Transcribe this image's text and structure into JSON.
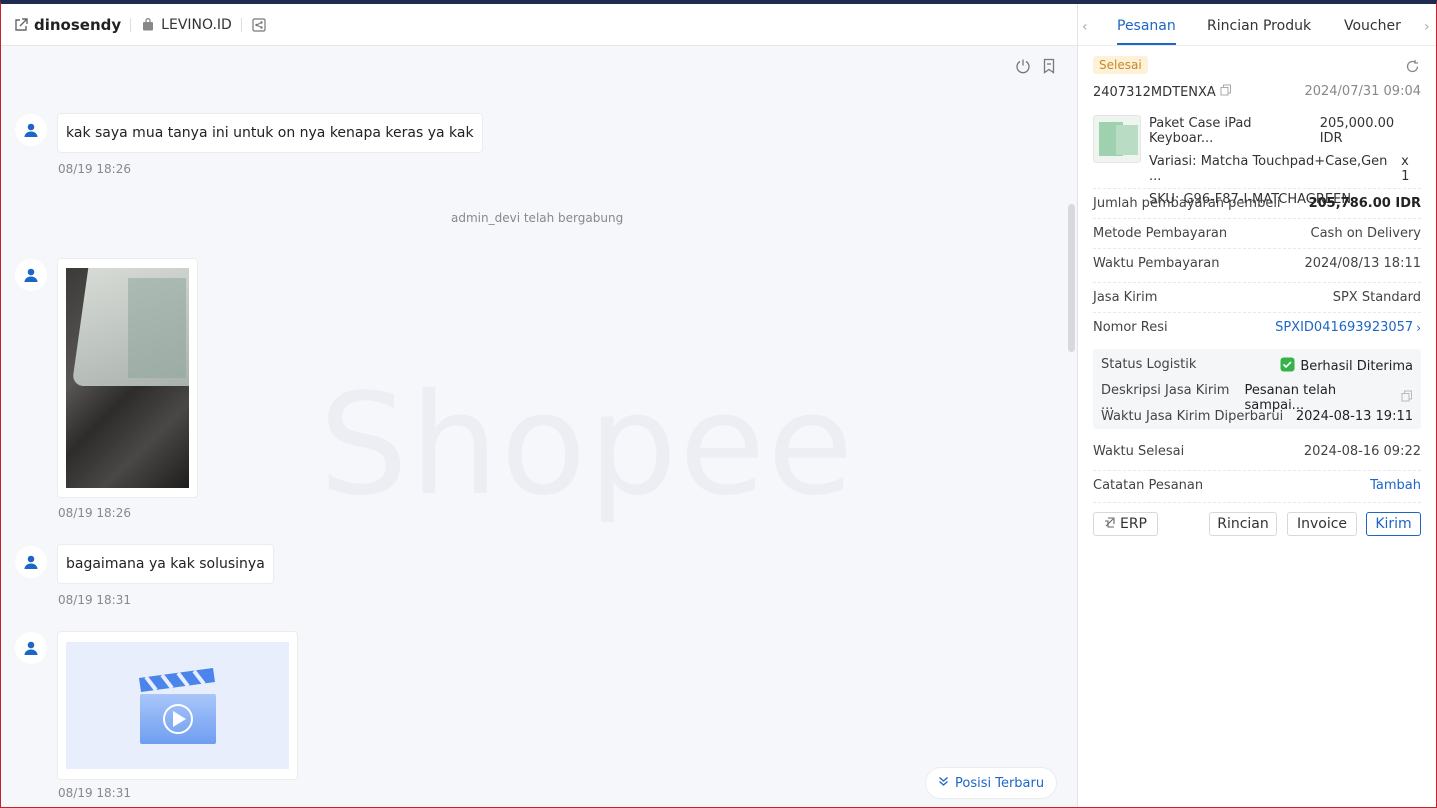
{
  "header": {
    "username": "dinosendy",
    "shop": "LEVINO.ID"
  },
  "chat": {
    "watermark": "Shopee",
    "messages": [
      {
        "type": "text",
        "text": "kak saya mua tanya ini untuk on nya kenapa keras ya kak",
        "time": "08/19 18:26"
      },
      {
        "type": "system",
        "text": "admin_devi telah bergabung"
      },
      {
        "type": "image",
        "time": "08/19 18:26"
      },
      {
        "type": "text",
        "text": "bagaimana ya kak solusinya",
        "time": "08/19 18:31"
      },
      {
        "type": "video",
        "time": "08/19 18:31"
      }
    ],
    "latest_button": "Posisi Terbaru"
  },
  "panel": {
    "tabs": [
      "Pesanan",
      "Rincian Produk",
      "Voucher"
    ],
    "active_tab": "Pesanan",
    "status": "Selesai",
    "order_id": "2407312MDTENXA",
    "order_time": "2024/07/31 09:04",
    "product": {
      "name": "Paket Case iPad Keyboar...",
      "price": "205,000.00 IDR",
      "variation_label": "Variasi:",
      "variation": "Matcha Touchpad+Case,Gen ...",
      "qty": "x 1",
      "sku_label": "SKU:",
      "sku": "G96-F87-I-MATCHAGREEN"
    },
    "rows": {
      "payment_amount_label": "Jumlah pembayaran pembeli",
      "payment_amount": "205,786.00 IDR",
      "method_label": "Metode Pembayaran",
      "method": "Cash on Delivery",
      "pay_time_label": "Waktu Pembayaran",
      "pay_time": "2024/08/13 18:11",
      "courier_label": "Jasa Kirim",
      "courier": "SPX Standard",
      "tracking_label": "Nomor Resi",
      "tracking": "SPXID041693923057",
      "logi_status_label": "Status Logistik",
      "logi_status": "Berhasil Diterima",
      "logi_desc_label": "Deskripsi Jasa Kirim ...",
      "logi_desc": "Pesanan telah sampai...",
      "logi_update_label": "Waktu Jasa Kirim Diperbarui",
      "logi_update": "2024-08-13 19:11",
      "done_label": "Waktu Selesai",
      "done": "2024-08-16 09:22",
      "note_label": "Catatan Pesanan",
      "note_action": "Tambah"
    },
    "buttons": {
      "erp": "ERP",
      "rincian": "Rincian",
      "invoice": "Invoice",
      "kirim": "Kirim"
    }
  }
}
